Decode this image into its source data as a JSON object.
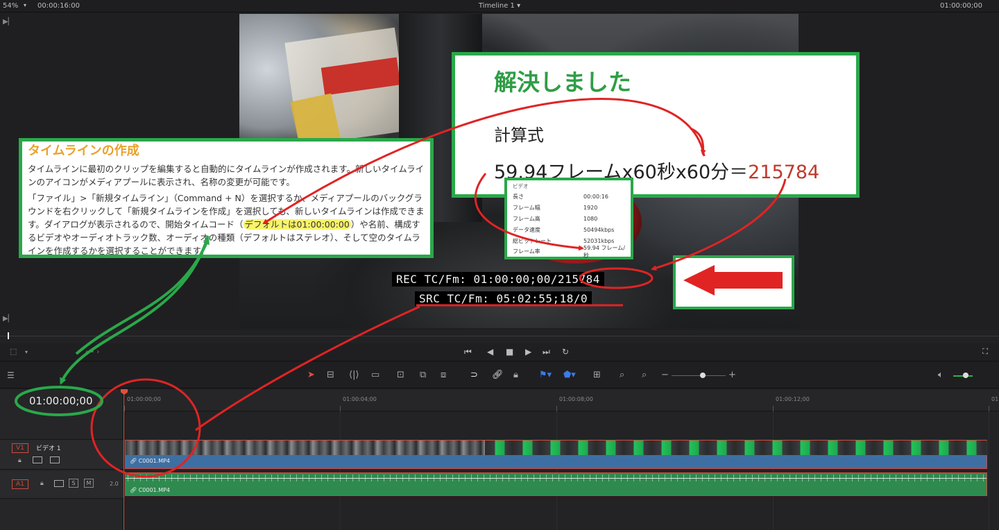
{
  "topbar": {
    "zoom": "54%",
    "duration": "00:00:16:00",
    "timeline_title": "Timeline 1",
    "timecode": "01:00:00;00"
  },
  "viewer": {
    "rec_tc": "REC TC/Fm: 01:00:00;00/215784",
    "src_tc": "SRC TC/Fm: 05:02:55;18/0"
  },
  "doc_box": {
    "title": "タイムラインの作成",
    "para1": "タイムラインに最初のクリップを編集すると自動的にタイムラインが作成されます。新しいタイムラインのアイコンがメディアプールに表示され、名称の変更が可能です。",
    "para2_a": "「ファイル」>「新規タイムライン」（Command + N）を選択するか、メディアプールのバックグラウンドを右クリックして「新規タイムラインを作成」を選択しても、新しいタイムラインは作成できます。ダイアログが表示されるので、開始タイムコード（",
    "para2_hl": "デフォルトは01:00:00:00",
    "para2_b": "）や名前、構成するビデオやオーディオトラック数、オーディオの種類（デフォルトはステレオ）、そして空のタイムラインを作成するかを選択することができます。"
  },
  "solve_box": {
    "title": "解決しました",
    "calc_label": "計算式",
    "calc_expr": "59.94フレームx60秒x60分＝",
    "calc_result": "215784"
  },
  "props_box": {
    "header": "ビデオ",
    "rows": [
      {
        "k": "長さ",
        "v": "00:00:16"
      },
      {
        "k": "フレーム幅",
        "v": "1920"
      },
      {
        "k": "フレーム高",
        "v": "1080"
      },
      {
        "k": "データ速度",
        "v": "50494kbps"
      },
      {
        "k": "総ビットレート",
        "v": "52031kbps"
      },
      {
        "k": "フレーム率",
        "v": "59.94 フレーム/秒"
      }
    ]
  },
  "timeline": {
    "timecode": "01:00:00;00",
    "ruler": [
      "01:00:00;00",
      "01:00:04;00",
      "01:00:08;00",
      "01:00:12;00",
      "01"
    ],
    "v1": {
      "id": "V1",
      "name": "ビデオ 1",
      "clip": "C0001.MP4"
    },
    "a1": {
      "id": "A1",
      "solo": "S",
      "mute": "M",
      "channels": "2.0",
      "clip": "C0001.MP4"
    }
  },
  "colors": {
    "annotation_green": "#2aa84a",
    "annotation_red": "#e02424",
    "accent_red": "#e0503c",
    "video_clip": "#3e6fa3",
    "audio_clip": "#2f8a4f"
  }
}
